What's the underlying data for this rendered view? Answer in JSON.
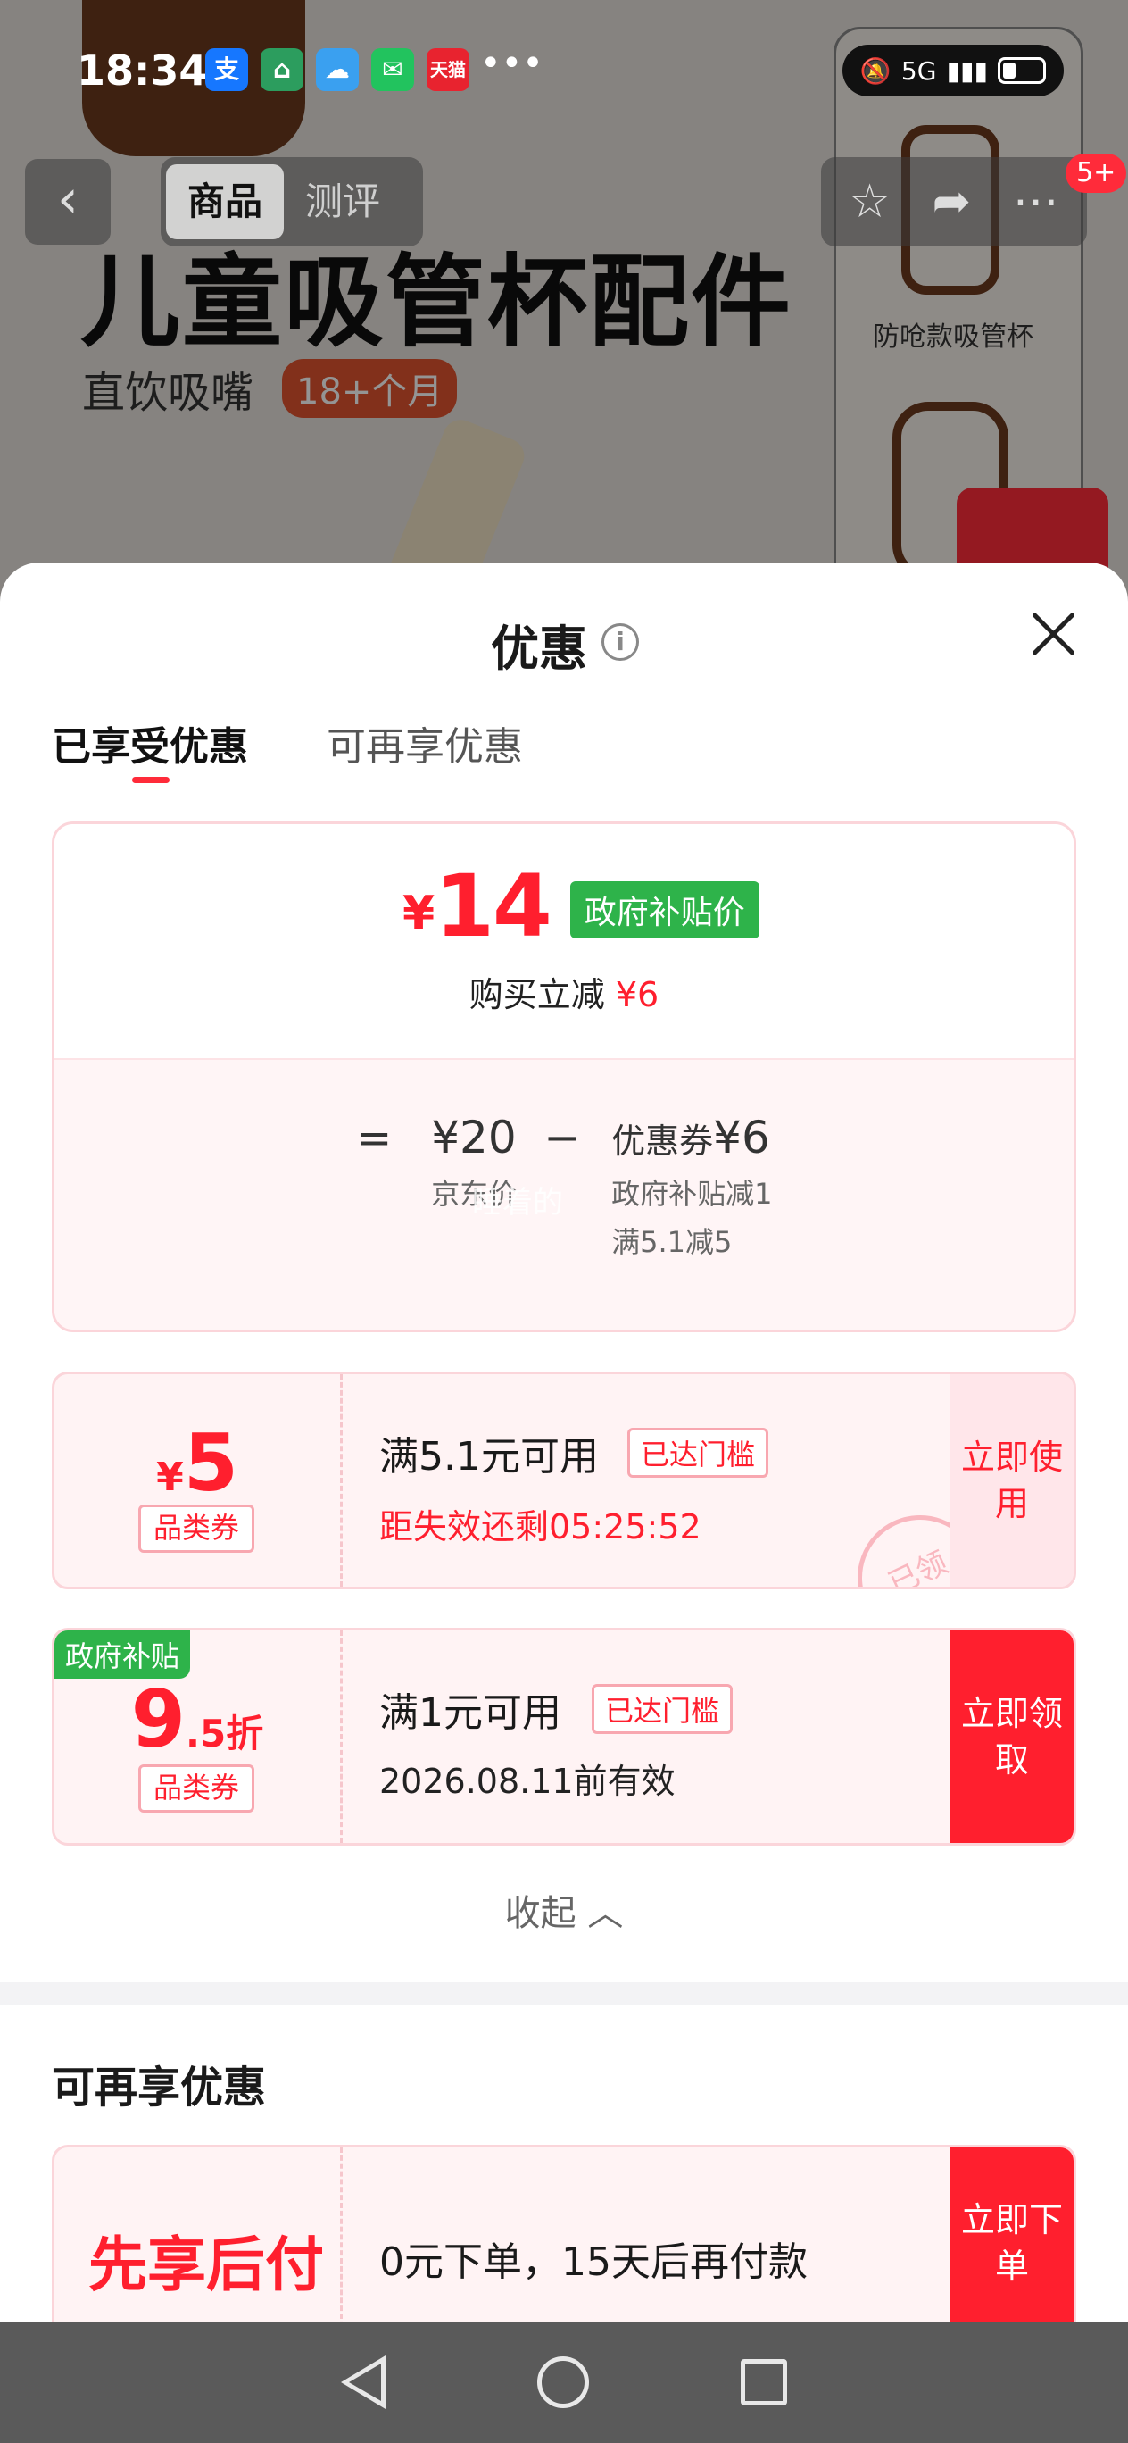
{
  "status_bar": {
    "time": "18:34",
    "apps": [
      "alipay-icon",
      "home-app-icon",
      "weather-icon",
      "wechat-icon",
      "tmall-icon"
    ],
    "tmall_label": "天猫",
    "more": "•••",
    "network": "5G"
  },
  "background_page": {
    "title": "儿童吸管杯配件",
    "subtitle": "直饮吸嘴",
    "age_tag": "18+个月",
    "thumb_label": "防呛款吸管杯",
    "tabs": [
      "商品",
      "测评"
    ],
    "cart_badge": "5+"
  },
  "sheet": {
    "title": "优惠",
    "tabs": [
      "已享受优惠",
      "可再享优惠"
    ],
    "price": {
      "yen": "¥",
      "amount": "14",
      "gov_tag": "政府补贴价",
      "instant_prefix": "购买立减 ",
      "instant_value": "¥6"
    },
    "calc": {
      "eq": "=",
      "original": "¥20",
      "original_label": "京东价",
      "minus": "−",
      "coupon_label": "优惠券",
      "coupon_value": "¥6",
      "coupon_desc_1": "政府补贴减1",
      "coupon_desc_2": "满5.1减5",
      "ghost_text": "睡着的"
    },
    "coupon1": {
      "yen": "¥",
      "amount": "5",
      "category": "品类券",
      "title": "满5.1元可用",
      "tag": "已达门槛",
      "countdown": "距失效还剩05:25:52",
      "button": "立即使用",
      "stamp": "已领"
    },
    "coupon2": {
      "corner": "政府补贴",
      "amount": "9",
      "amount_suffix": ".5折",
      "category": "品类券",
      "title": "满1元可用",
      "tag": "已达门槛",
      "valid": "2026.08.11前有效",
      "button": "立即领取"
    },
    "collapse": "收起 ︿",
    "section2_title": "可再享优惠",
    "bnpl": {
      "title": "先享后付",
      "desc": "0元下单，15天后再付款",
      "button": "立即下单"
    }
  },
  "colors": {
    "accent_red": "#ff1f2e",
    "gov_green": "#2eb34a",
    "coupon_bg": "#fff3f4"
  }
}
